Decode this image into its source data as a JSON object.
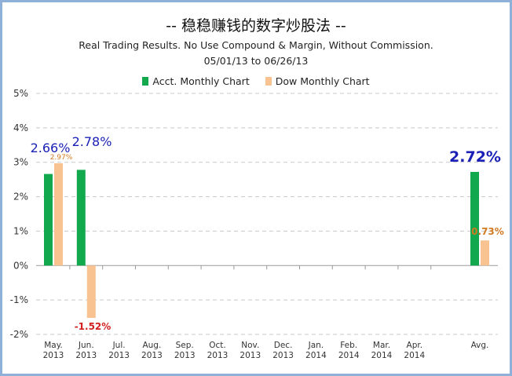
{
  "header": {
    "title": "--  稳稳赚钱的数字炒股法  --",
    "subtitle": "Real Trading Results. No Use Compound & Margin, Without Commission.",
    "date_range": "05/01/13  to  06/26/13"
  },
  "colors": {
    "acct": "#11a84e",
    "dow": "#f8c291",
    "acct_label": "#1a1fb5",
    "dow_label": "#d07a22",
    "negative_label": "#d21f1f",
    "grid": "#c8c8c8",
    "frame": "#8fb0d8"
  },
  "chart_data": {
    "type": "bar",
    "title": "--  稳稳赚钱的数字炒股法  --",
    "categories": [
      [
        "May.",
        "2013"
      ],
      [
        "Jun.",
        "2013"
      ],
      [
        "Jul.",
        "2013"
      ],
      [
        "Aug.",
        "2013"
      ],
      [
        "Sep.",
        "2013"
      ],
      [
        "Oct.",
        "2013"
      ],
      [
        "Nov.",
        "2013"
      ],
      [
        "Dec.",
        "2013"
      ],
      [
        "Jan.",
        "2014"
      ],
      [
        "Feb.",
        "2014"
      ],
      [
        "Mar.",
        "2014"
      ],
      [
        "Apr.",
        "2014"
      ],
      [
        "Avg.",
        ""
      ]
    ],
    "series": [
      {
        "name": "Acct. Monthly Chart",
        "values": [
          2.66,
          2.78,
          null,
          null,
          null,
          null,
          null,
          null,
          null,
          null,
          null,
          null,
          2.72
        ],
        "labels": [
          "2.66%",
          "2.78%",
          "",
          "",
          "",
          "",
          "",
          "",
          "",
          "",
          "",
          "",
          "2.72%"
        ]
      },
      {
        "name": "Dow Monthly Chart",
        "values": [
          2.97,
          -1.52,
          null,
          null,
          null,
          null,
          null,
          null,
          null,
          null,
          null,
          null,
          0.73
        ],
        "labels": [
          "2.97%",
          "-1.52%",
          "",
          "",
          "",
          "",
          "",
          "",
          "",
          "",
          "",
          "",
          "0.73%"
        ]
      }
    ],
    "ylim": [
      -2,
      5
    ],
    "yticks": [
      5,
      4,
      3,
      2,
      1,
      0,
      -1,
      -2
    ],
    "ytick_labels": [
      "5%",
      "4%",
      "3%",
      "2%",
      "1%",
      "0%",
      "-1%",
      "-2%"
    ],
    "grid": true,
    "legend_position": "top-center"
  }
}
